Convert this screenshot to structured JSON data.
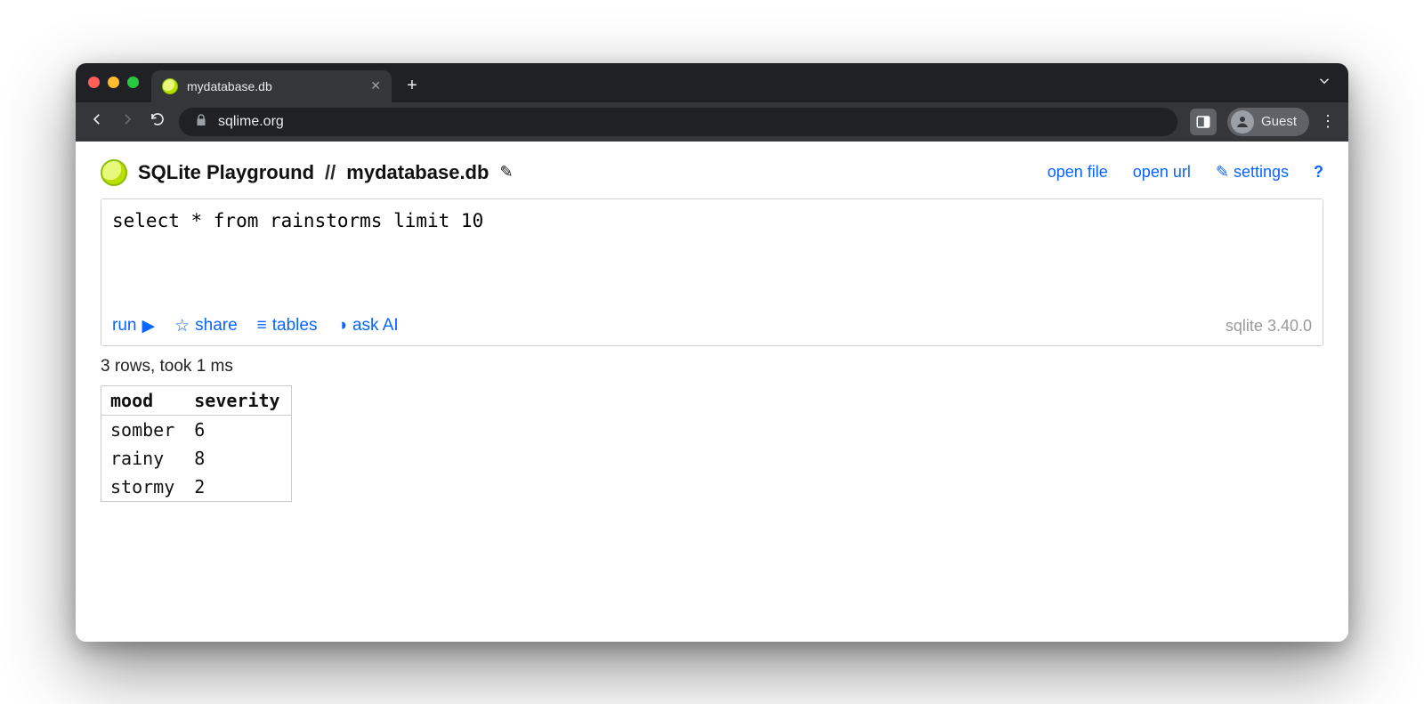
{
  "browser": {
    "tab_title": "mydatabase.db",
    "address": "sqlime.org",
    "guest_label": "Guest"
  },
  "header": {
    "app_title": "SQLite Playground",
    "separator": "//",
    "db_name": "mydatabase.db",
    "links": {
      "open_file": "open file",
      "open_url": "open url",
      "settings": "settings",
      "help": "?"
    }
  },
  "editor": {
    "sql": "select * from rainstorms limit 10"
  },
  "actions": {
    "run": "run",
    "share": "share",
    "tables": "tables",
    "ask_ai": "ask AI",
    "version": "sqlite 3.40.0"
  },
  "status": "3 rows, took 1 ms",
  "result": {
    "columns": [
      "mood",
      "severity"
    ],
    "rows": [
      {
        "mood": "somber",
        "severity": "6"
      },
      {
        "mood": "rainy",
        "severity": "8"
      },
      {
        "mood": "stormy",
        "severity": "2"
      }
    ]
  }
}
